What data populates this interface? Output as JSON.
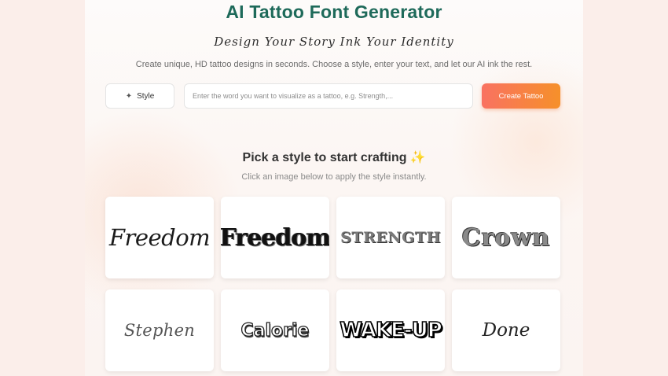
{
  "header": {
    "title": "AI Tattoo Font Generator",
    "tagline": "Design Your Story Ink Your Identity",
    "description": "Create unique, HD tattoo designs in seconds. Choose a style, enter your text, and let our AI ink the rest."
  },
  "controls": {
    "style_label": "Style",
    "style_icon": "sparkle-wand-icon",
    "input_placeholder": "Enter the word you want to visualize as a tattoo, e.g. Strength,...",
    "input_value": "",
    "create_label": "Create Tattoo",
    "accent_gradient": [
      "#f97261",
      "#f6902a"
    ]
  },
  "gallery": {
    "title": "Pick a style to start crafting",
    "title_icon": "sparkles-icon",
    "subtitle": "Click an image below to apply the style instantly.",
    "styles": [
      {
        "word": "Freedom"
      },
      {
        "word": "Freedom"
      },
      {
        "word": "STRENGTH"
      },
      {
        "word": "Crown"
      },
      {
        "word": "Stephen"
      },
      {
        "word": "Calorie"
      },
      {
        "word": "WAKE-UP"
      },
      {
        "word": "Done"
      }
    ]
  },
  "colors": {
    "title": "#1e6a5a",
    "background": "#fbeeea"
  }
}
